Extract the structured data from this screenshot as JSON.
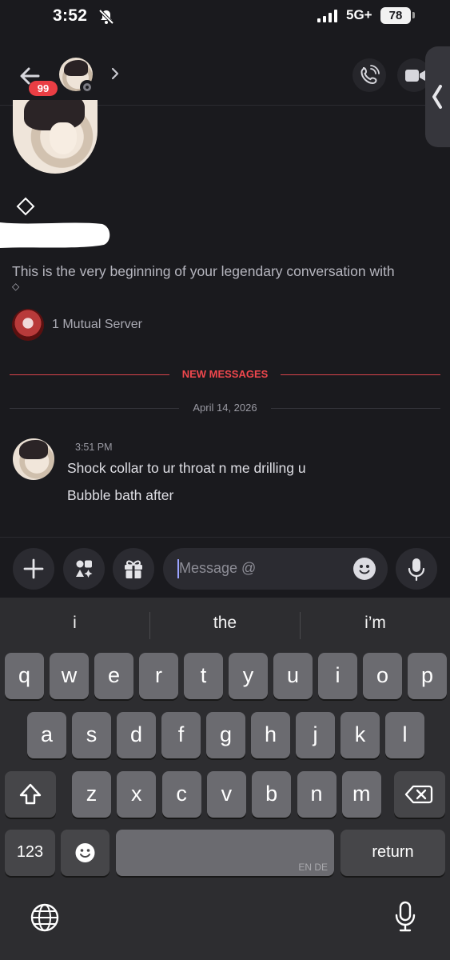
{
  "status_bar": {
    "time": "3:52",
    "network": "5G+",
    "battery": "78"
  },
  "header": {
    "unread_badge": "99"
  },
  "conversation": {
    "intro_text": "This is the very beginning of your legendary conversation with",
    "intro_name_glyph": "◇",
    "mutual_servers": "1 Mutual Server",
    "new_messages_label": "NEW MESSAGES",
    "date_label": "April 14, 2026",
    "message": {
      "time": "3:51 PM",
      "lines": [
        "Shock collar to ur throat n me drilling u",
        "Bubble bath after"
      ]
    }
  },
  "composer": {
    "placeholder": "Message @"
  },
  "keyboard": {
    "suggestions": [
      "i",
      "the",
      "i’m"
    ],
    "row1": [
      "q",
      "w",
      "e",
      "r",
      "t",
      "y",
      "u",
      "i",
      "o",
      "p"
    ],
    "row2": [
      "a",
      "s",
      "d",
      "f",
      "g",
      "h",
      "j",
      "k",
      "l"
    ],
    "row3": [
      "z",
      "x",
      "c",
      "v",
      "b",
      "n",
      "m"
    ],
    "numbers_label": "123",
    "space_lang": "EN DE",
    "return_label": "return"
  },
  "colors": {
    "accent_red": "#f0474d",
    "background": "#1a1a1e",
    "keyboard_bg": "#2d2d30"
  },
  "icons": [
    "back-arrow-icon",
    "chevron-right-icon",
    "phone-icon",
    "video-icon",
    "plus-icon",
    "apps-icon",
    "gift-icon",
    "emoji-icon",
    "mic-icon",
    "shift-icon",
    "delete-icon",
    "globe-icon",
    "dictation-icon"
  ]
}
